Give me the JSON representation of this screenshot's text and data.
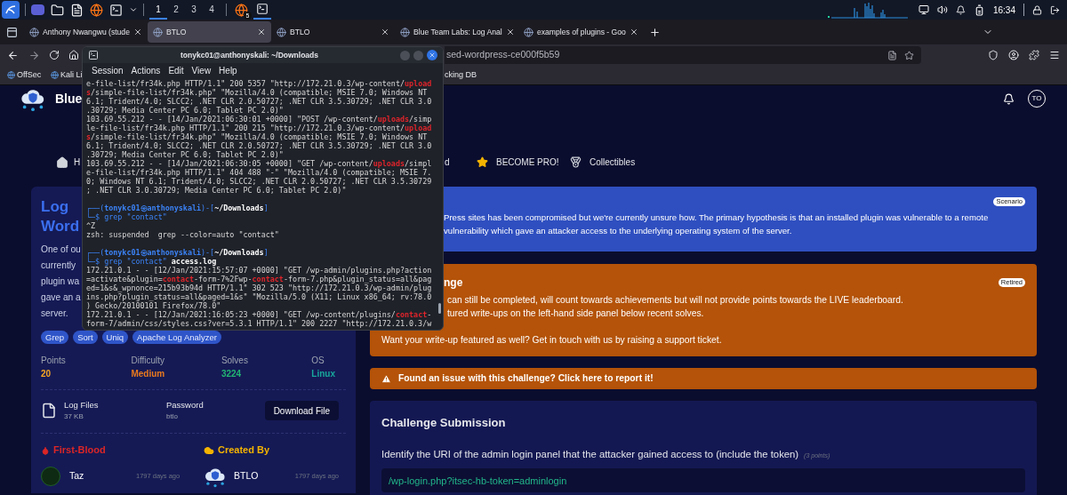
{
  "taskbar": {
    "workspaces": [
      {
        "label": "1",
        "selected": true
      },
      {
        "label": "2",
        "selected": false
      },
      {
        "label": "3",
        "selected": false
      },
      {
        "label": "4",
        "selected": false
      }
    ],
    "browser_badge": "5",
    "clock": "16:34"
  },
  "browser": {
    "tabs": [
      {
        "label": "Anthony Nwangwu (stude",
        "selected": false
      },
      {
        "label": "BTLO",
        "selected": true
      },
      {
        "label": "BTLO",
        "selected": false
      },
      {
        "label": "Blue Team Labs: Log Anal",
        "selected": false
      },
      {
        "label": "examples of plugins - Goo",
        "selected": false
      }
    ],
    "url": "sed-wordpress-ce000f5b59",
    "bookmarks": [
      {
        "label": "OffSec"
      },
      {
        "label": "Kali Li"
      },
      {
        "label": "cking DB"
      }
    ]
  },
  "page": {
    "brand": "Blue",
    "nav": [
      {
        "label": "H"
      },
      {
        "label": "d"
      },
      {
        "label": "BECOME PRO!"
      },
      {
        "label": "Collectibles"
      }
    ],
    "avatar": "TO",
    "challenge": {
      "title_lines": [
        "Log",
        "Word"
      ],
      "description_lines": [
        "One of ou",
        "currently",
        "plugin wa",
        "gave an a",
        "server."
      ],
      "tags": [
        "Grep",
        "Sort",
        "Uniq",
        "Apache Log Analyzer"
      ],
      "stats": [
        {
          "label": "Points",
          "value": "20",
          "color": "#f5a524"
        },
        {
          "label": "Difficulty",
          "value": "Medium",
          "color": "#ea7a1e"
        },
        {
          "label": "Solves",
          "value": "3224",
          "color": "#22b573"
        },
        {
          "label": "OS",
          "value": "Linux",
          "color": "#18a89c"
        }
      ],
      "file": {
        "name": "Log Files",
        "size": "37 KB",
        "password_label": "Password",
        "password": "btlo",
        "button": "Download File"
      },
      "first_blood": {
        "heading": "First-Blood",
        "user": "Taz",
        "time": "1797 days ago"
      },
      "created_by": {
        "heading": "Created By",
        "user": "BTLO",
        "time": "1797 days ago"
      }
    },
    "scenario": {
      "badge": "Scenario",
      "lines": [
        "Press sites has been compromised but we're currently unsure how. The primary hypothesis is that an installed plugin was vulnerable to a remote",
        "vulnerability which gave an attacker access to the underlying operating system of the server."
      ]
    },
    "retired": {
      "title": "nge",
      "badge": "Retired",
      "lines": [
        "can still be completed, will count towards achievements but will not provide points towards the LIVE leaderboard.",
        "tured write-ups on the left-hand side panel below recent solves."
      ],
      "note": "Want your write-up featured as well? Get in touch with us by raising a support ticket."
    },
    "report": "Found an issue with this challenge? Click here to report it!",
    "submission": {
      "title": "Challenge Submission",
      "question": "Identify the URI of the admin login panel that the attacker gained access to (include the token)",
      "points": "(3 points)",
      "answer": "/wp-login.php?itsec-hb-token=adminlogin"
    }
  },
  "terminal": {
    "title": "tonykc01@anthonyskali: ~/Downloads",
    "menu": [
      "Session",
      "Actions",
      "Edit",
      "View",
      "Help"
    ],
    "lines": [
      {
        "kind": "output",
        "parts": [
          {
            "text": "e-file-list/fr34k.php HTTP/1.1\" 200 5357 \"http://172.21.0.3/wp-content/",
            "highlight": false
          },
          {
            "text": "upload",
            "highlight": true
          }
        ]
      },
      {
        "kind": "output",
        "parts": [
          {
            "text": "s",
            "highlight": true
          },
          {
            "text": "/simple-file-list/fr34k.php\" \"Mozilla/4.0 (compatible; MSIE 7.0; Windows NT",
            "highlight": false
          }
        ]
      },
      {
        "kind": "output",
        "parts": [
          {
            "text": "6.1; Trident/4.0; SLCC2; .NET CLR 2.0.50727; .NET CLR 3.5.30729; .NET CLR 3.0",
            "highlight": false
          }
        ]
      },
      {
        "kind": "output",
        "parts": [
          {
            "text": ".30729; Media Center PC 6.0; Tablet PC 2.0)\"",
            "highlight": false
          }
        ]
      },
      {
        "kind": "output",
        "parts": [
          {
            "text": "103.69.55.212 - - [14/Jan/2021:06:30:01 +0000] \"POST /wp-content/",
            "highlight": false
          },
          {
            "text": "uploads",
            "highlight": true
          },
          {
            "text": "/simp",
            "highlight": false
          }
        ]
      },
      {
        "kind": "output",
        "parts": [
          {
            "text": "le-file-list/fr34k.php HTTP/1.1\" 200 215 \"http://172.21.0.3/wp-content/",
            "highlight": false
          },
          {
            "text": "upload",
            "highlight": true
          }
        ]
      },
      {
        "kind": "output",
        "parts": [
          {
            "text": "s",
            "highlight": true
          },
          {
            "text": "/simple-file-list/fr34k.php\" \"Mozilla/4.0 (compatible; MSIE 7.0; Windows NT",
            "highlight": false
          }
        ]
      },
      {
        "kind": "output",
        "parts": [
          {
            "text": "6.1; Trident/4.0; SLCC2; .NET CLR 2.0.50727; .NET CLR 3.5.30729; .NET CLR 3.0",
            "highlight": false
          }
        ]
      },
      {
        "kind": "output",
        "parts": [
          {
            "text": ".30729; Media Center PC 6.0; Tablet PC 2.0)\"",
            "highlight": false
          }
        ]
      },
      {
        "kind": "output",
        "parts": [
          {
            "text": "103.69.55.212 - - [14/Jan/2021:06:30:05 +0000] \"GET /wp-content/",
            "highlight": false
          },
          {
            "text": "uploads",
            "highlight": true
          },
          {
            "text": "/simpl",
            "highlight": false
          }
        ]
      },
      {
        "kind": "output",
        "parts": [
          {
            "text": "e-file-list/fr34k.php HTTP/1.1\" 404 488 \"-\" \"Mozilla/4.0 (compatible; MSIE 7.",
            "highlight": false
          }
        ]
      },
      {
        "kind": "output",
        "parts": [
          {
            "text": "0; Windows NT 6.1; Trident/4.0; SLCC2; .NET CLR 2.0.50727; .NET CLR 3.5.30729",
            "highlight": false
          }
        ]
      },
      {
        "kind": "output",
        "parts": [
          {
            "text": "; .NET CLR 3.0.30729; Media Center PC 6.0; Tablet PC 2.0)\"",
            "highlight": false
          }
        ]
      },
      {
        "kind": "blank"
      },
      {
        "kind": "prompt",
        "open": "┌──(",
        "user": "tonykc01㉿anthonyskali",
        "mid": ")-[",
        "path": "~/Downloads",
        "close": "]"
      },
      {
        "kind": "command",
        "lead": "└─$",
        "command": "grep \"contact\""
      },
      {
        "kind": "output",
        "parts": [
          {
            "text": "^Z",
            "highlight": false
          }
        ]
      },
      {
        "kind": "output",
        "parts": [
          {
            "text": "zsh: suspended  grep --color=auto \"contact\"",
            "highlight": false
          }
        ]
      },
      {
        "kind": "blank"
      },
      {
        "kind": "prompt",
        "open": "┌──(",
        "user": "tonykc01㉿anthonyskali",
        "mid": ")-[",
        "path": "~/Downloads",
        "close": "]"
      },
      {
        "kind": "command",
        "lead": "└─$",
        "command": "grep \"contact\"",
        "arg": "access.log"
      },
      {
        "kind": "output",
        "parts": [
          {
            "text": "172.21.0.1 - - [12/Jan/2021:15:57:07 +0000] \"GET /wp-admin/plugins.php?action",
            "highlight": false
          }
        ]
      },
      {
        "kind": "output",
        "parts": [
          {
            "text": "=activate&plugin=",
            "highlight": false
          },
          {
            "text": "contact",
            "highlight": true
          },
          {
            "text": "-form-7%2Fwp-",
            "highlight": false
          },
          {
            "text": "contact",
            "highlight": true
          },
          {
            "text": "-form-7.php&plugin_status=all&pag",
            "highlight": false
          }
        ]
      },
      {
        "kind": "output",
        "parts": [
          {
            "text": "ed=1&s&_wpnonce=215b93b94d HTTP/1.1\" 302 523 \"http://172.21.0.3/wp-admin/plug",
            "highlight": false
          }
        ]
      },
      {
        "kind": "output",
        "parts": [
          {
            "text": "ins.php?plugin_status=all&paged=1&s\" \"Mozilla/5.0 (X11; Linux x86_64; rv:78.0",
            "highlight": false
          }
        ]
      },
      {
        "kind": "output",
        "parts": [
          {
            "text": ") Gecko/20100101 Firefox/78.0\"",
            "highlight": false
          }
        ]
      },
      {
        "kind": "output",
        "parts": [
          {
            "text": "172.21.0.1 - - [12/Jan/2021:16:05:23 +0000] \"GET /wp-content/plugins/",
            "highlight": false
          },
          {
            "text": "contact",
            "highlight": true
          },
          {
            "text": "-",
            "highlight": false
          }
        ]
      },
      {
        "kind": "output",
        "parts": [
          {
            "text": "form-7/admin/css/styles.css?ver=5.3.1 HTTP/1.1\" 200 2227 \"http://172.21.0.3/w",
            "highlight": false
          }
        ]
      }
    ]
  }
}
